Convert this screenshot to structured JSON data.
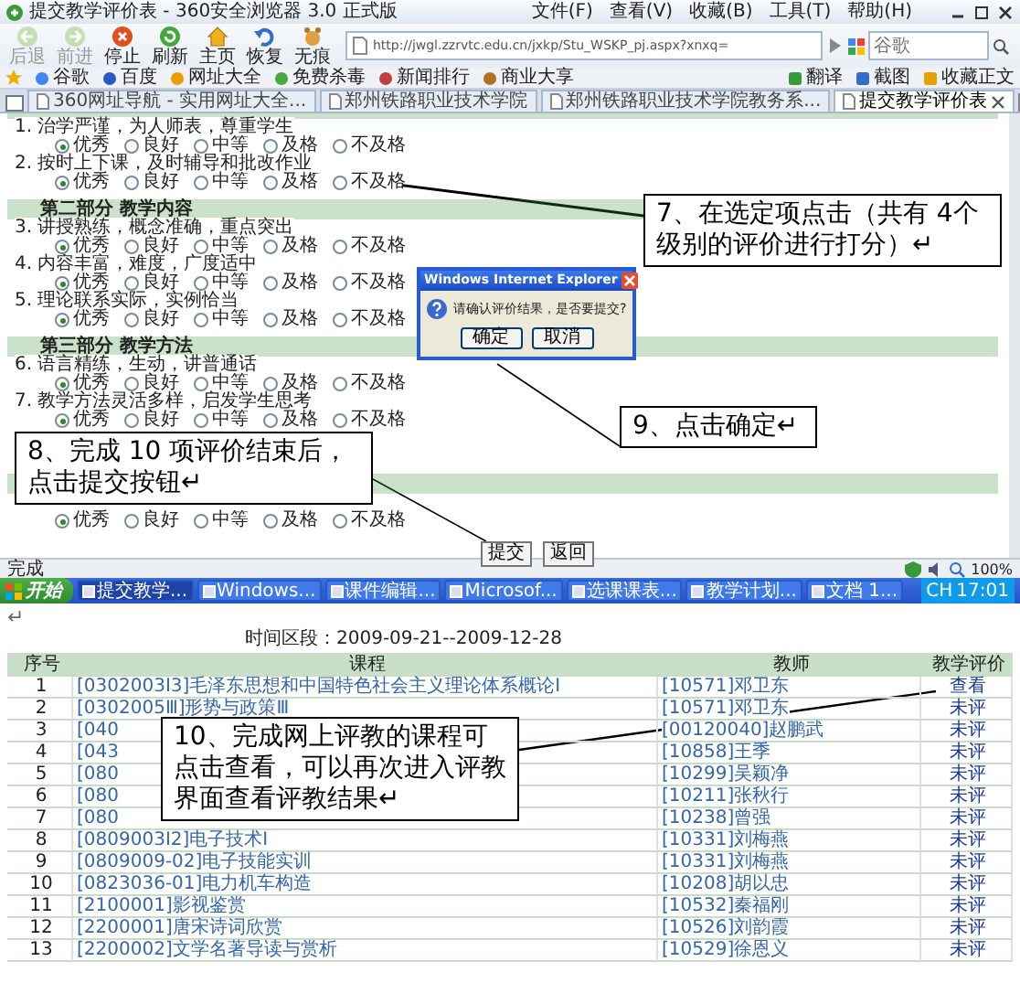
{
  "window": {
    "title": "提交教学评价表 - 360安全浏览器 3.0 正式版",
    "menu": [
      "文件(F)",
      "查看(V)",
      "收藏(B)",
      "工具(T)",
      "帮助(H)"
    ]
  },
  "toolbar": {
    "buttons": [
      {
        "kind": "back",
        "label": "后退",
        "disabled": true
      },
      {
        "kind": "forward",
        "label": "前进",
        "disabled": true
      },
      {
        "kind": "stop",
        "label": "停止",
        "disabled": false
      },
      {
        "kind": "refresh",
        "label": "刷新",
        "disabled": false
      },
      {
        "kind": "home",
        "label": "主页",
        "disabled": false
      },
      {
        "kind": "restore",
        "label": "恢复",
        "disabled": false
      },
      {
        "kind": "incognito",
        "label": "无痕",
        "disabled": false
      }
    ],
    "address": "http://jwgl.zzrvtc.edu.cn/jxkp/Stu_WSKP_pj.aspx?xnxq=",
    "search": {
      "placeholder": "谷歌"
    }
  },
  "bookmarks": {
    "items": [
      "谷歌",
      "百度",
      "网址大全",
      "免费杀毒",
      "新闻排行",
      "商业大享"
    ],
    "tools": [
      "翻译",
      "截图",
      "收藏正文"
    ]
  },
  "tabs": [
    {
      "label": "360网址导航 - 实用网址大全...",
      "selected": false
    },
    {
      "label": "郑州铁路职业技术学院",
      "selected": false
    },
    {
      "label": "郑州铁路职业技术学院教务系...",
      "selected": false
    },
    {
      "label": "提交教学评价表",
      "selected": true
    }
  ],
  "form": {
    "sections": [
      {
        "questions": [
          {
            "kind": "question",
            "text": "1. 治学严谨，为人师表，尊重学生",
            "options": [
              {
                "label": "优秀",
                "selected": true
              },
              {
                "label": "良好",
                "selected": false
              },
              {
                "label": "中等",
                "selected": false
              },
              {
                "label": "及格",
                "selected": false
              },
              {
                "label": "不及格",
                "selected": false
              }
            ]
          },
          {
            "kind": "question",
            "text": "2. 按时上下课，及时辅导和批改作业",
            "options": [
              {
                "label": "优秀",
                "selected": true
              },
              {
                "label": "良好",
                "selected": false
              },
              {
                "label": "中等",
                "selected": false
              },
              {
                "label": "及格",
                "selected": false
              },
              {
                "label": "不及格",
                "selected": false
              }
            ]
          }
        ]
      },
      {
        "title": "第二部分 教学内容",
        "questions": [
          {
            "kind": "question",
            "text": "3. 讲授熟练，概念准确，重点突出",
            "options": [
              {
                "label": "优秀",
                "selected": true
              },
              {
                "label": "良好",
                "selected": false
              },
              {
                "label": "中等",
                "selected": false
              },
              {
                "label": "及格",
                "selected": false
              },
              {
                "label": "不及格",
                "selected": false
              }
            ]
          },
          {
            "kind": "question",
            "text": "4. 内容丰富，难度，广度适中",
            "options": [
              {
                "label": "优秀",
                "selected": true
              },
              {
                "label": "良好",
                "selected": false
              },
              {
                "label": "中等",
                "selected": false
              },
              {
                "label": "及格",
                "selected": false
              },
              {
                "label": "不及格",
                "selected": false
              }
            ]
          },
          {
            "kind": "question",
            "text": "5. 理论联系实际，实例恰当",
            "options": [
              {
                "label": "优秀",
                "selected": true
              },
              {
                "label": "良好",
                "selected": false
              },
              {
                "label": "中等",
                "selected": false
              },
              {
                "label": "及格",
                "selected": false
              },
              {
                "label": "不及格",
                "selected": false
              }
            ]
          }
        ]
      },
      {
        "title": "第三部分 教学方法",
        "questions": [
          {
            "kind": "question",
            "text": "6. 语言精练，生动，讲普通话",
            "options": [
              {
                "label": "优秀",
                "selected": true
              },
              {
                "label": "良好",
                "selected": false
              },
              {
                "label": "中等",
                "selected": false
              },
              {
                "label": "及格",
                "selected": false
              },
              {
                "label": "不及格",
                "selected": false
              }
            ]
          },
          {
            "kind": "question",
            "text": "7. 教学方法灵活多样，启发学生思考",
            "options": [
              {
                "label": "优秀",
                "selected": true
              },
              {
                "label": "良好",
                "selected": false
              },
              {
                "label": "中等",
                "selected": false
              },
              {
                "label": "及格",
                "selected": false
              },
              {
                "label": "不及格",
                "selected": false
              }
            ]
          },
          {
            "kind": "covered"
          },
          {
            "kind": "covered"
          }
        ]
      },
      {
        "questions": [
          {
            "kind": "question",
            "options": [
              {
                "label": "优秀",
                "selected": true
              },
              {
                "label": "良好",
                "selected": false
              },
              {
                "label": "中等",
                "selected": false
              },
              {
                "label": "及格",
                "selected": false
              },
              {
                "label": "不及格",
                "selected": false
              }
            ]
          }
        ]
      }
    ],
    "buttons": [
      "提交",
      "返回"
    ]
  },
  "dialog": {
    "title": "Windows Internet Explorer",
    "message": "请确认评价结果，是否要提交?",
    "buttons": [
      "确定",
      "取消"
    ]
  },
  "status_bar": {
    "text": "完成",
    "zoom": "100%"
  },
  "taskbar": {
    "start": "开始",
    "tasks": [
      {
        "label": "提交教学...",
        "selected": true
      },
      {
        "label": "Windows...",
        "selected": false
      },
      {
        "label": "课件编辑...",
        "selected": false
      },
      {
        "label": "Microsof...",
        "selected": false
      },
      {
        "label": "选课课表...",
        "selected": false
      },
      {
        "label": "教学计划...",
        "selected": false
      },
      {
        "label": "文档 1...",
        "selected": false
      }
    ],
    "language": "CH",
    "clock": "17:01"
  },
  "paragraph_mark": "↵",
  "table": {
    "period": "时间区段：2009-09-21--2009-12-28",
    "columns": [
      "序号",
      "课程",
      "教师",
      "教学评价"
    ],
    "rows": [
      [
        "1",
        "[0302003Ⅰ3]毛泽东思想和中国特色社会主义理论体系概论Ⅰ",
        "[10571]邓卫东",
        "查看"
      ],
      [
        "2",
        "[0302005Ⅲ]形势与政策Ⅲ",
        "[10571]邓卫东",
        "未评"
      ],
      [
        "3",
        "[040",
        "[00120040]赵鹏武",
        "未评"
      ],
      [
        "4",
        "[043",
        "[10858]王季",
        "未评"
      ],
      [
        "5",
        "[080",
        "[10299]吴颖净",
        "未评"
      ],
      [
        "6",
        "[080",
        "[10211]张秋行",
        "未评"
      ],
      [
        "7",
        "[080",
        "[10238]曾强",
        "未评"
      ],
      [
        "8",
        "[0809003Ⅰ2]电子技术Ⅰ",
        "[10331]刘梅燕",
        "未评"
      ],
      [
        "9",
        "[0809009-02]电子技能实训",
        "[10331]刘梅燕",
        "未评"
      ],
      [
        "10",
        "[0823036-01]电力机车构造",
        "[10208]胡以忠",
        "未评"
      ],
      [
        "11",
        "[2100001]影视鉴赏",
        "[10532]秦福刚",
        "未评"
      ],
      [
        "12",
        "[2200001]唐宋诗词欣赏",
        "[10526]刘韵霞",
        "未评"
      ],
      [
        "13",
        "[2200002]文学名著导读与赏析",
        "[10529]徐恩义",
        "未评"
      ]
    ]
  },
  "callouts": [
    {
      "text": "7、在选定项点击（共有 4个级别的评价进行打分）↵"
    },
    {
      "text": "8、完成 10 项评价结束后，点击提交按钮↵"
    },
    {
      "text": "9、点击确定↵"
    },
    {
      "text": "10、完成网上评教的课程可点击查看，可以再次进入评教界面查看评教结果↵"
    }
  ]
}
